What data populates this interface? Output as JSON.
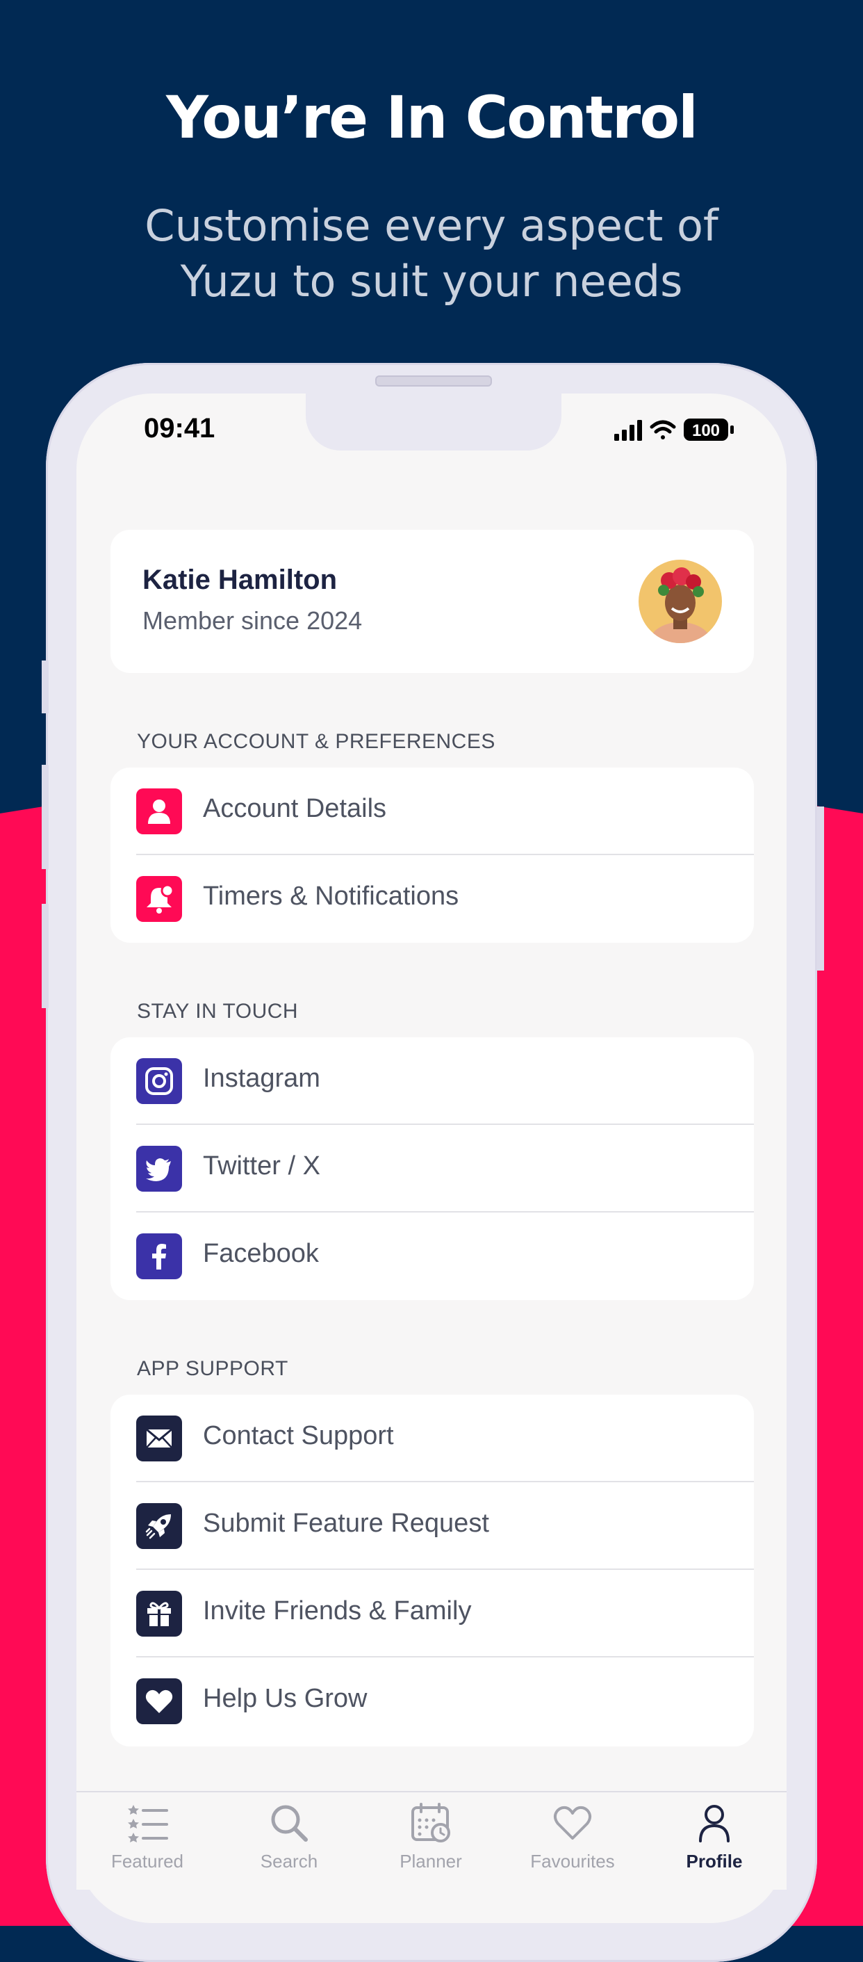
{
  "hero": {
    "title": "You’re In Control",
    "subtitle_line1": "Customise every aspect of",
    "subtitle_line2": "Yuzu to suit your needs"
  },
  "status_bar": {
    "time": "09:41",
    "battery": "100"
  },
  "profile": {
    "name": "Katie Hamilton",
    "member_since": "Member since 2024"
  },
  "sections": [
    {
      "title": "YOUR ACCOUNT & PREFERENCES",
      "items": [
        {
          "label": "Account Details",
          "icon": "person-icon"
        },
        {
          "label": "Timers & Notifications",
          "icon": "bell-icon"
        }
      ]
    },
    {
      "title": "STAY IN TOUCH",
      "items": [
        {
          "label": "Instagram",
          "icon": "instagram-icon"
        },
        {
          "label": "Twitter / X",
          "icon": "twitter-icon"
        },
        {
          "label": "Facebook",
          "icon": "facebook-icon"
        }
      ]
    },
    {
      "title": "APP SUPPORT",
      "items": [
        {
          "label": "Contact Support",
          "icon": "envelope-icon"
        },
        {
          "label": "Submit Feature Request",
          "icon": "rocket-icon"
        },
        {
          "label": "Invite Friends & Family",
          "icon": "gift-icon"
        },
        {
          "label": "Help Us Grow",
          "icon": "heart-icon"
        }
      ]
    }
  ],
  "tabs": [
    {
      "label": "Featured",
      "icon": "featured-list-icon",
      "active": false
    },
    {
      "label": "Search",
      "icon": "search-icon",
      "active": false
    },
    {
      "label": "Planner",
      "icon": "calendar-icon",
      "active": false
    },
    {
      "label": "Favourites",
      "icon": "heart-outline-icon",
      "active": false
    },
    {
      "label": "Profile",
      "icon": "person-outline-icon",
      "active": true
    }
  ],
  "colors": {
    "navy": "#012953",
    "pink": "#FF0A55",
    "purple": "#3B32A8",
    "dark": "#1D2342"
  }
}
